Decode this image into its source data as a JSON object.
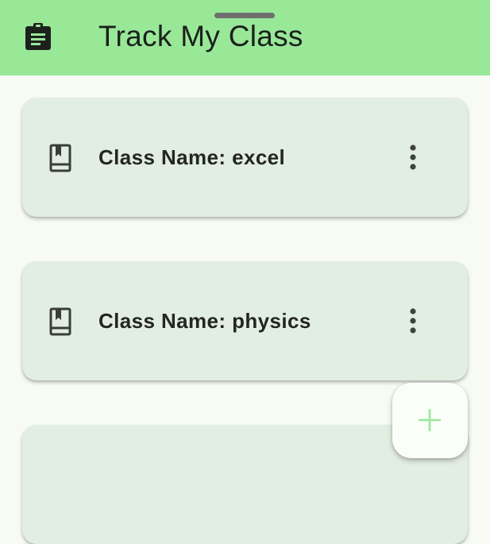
{
  "app_bar": {
    "title": "Track My Class",
    "icon": "clipboard-icon",
    "background_color": "#98e898"
  },
  "classes": [
    {
      "label": "Class Name: excel",
      "icon": "book-icon",
      "menu_icon": "more-vert-icon"
    },
    {
      "label": "Class Name: physics",
      "icon": "book-icon",
      "menu_icon": "more-vert-icon"
    },
    {
      "label": "",
      "icon": "",
      "menu_icon": ""
    }
  ],
  "fab": {
    "icon": "plus-icon",
    "icon_color": "#98e898"
  },
  "colors": {
    "card_background": "#e3eee3",
    "page_background": "#f8faf4"
  }
}
